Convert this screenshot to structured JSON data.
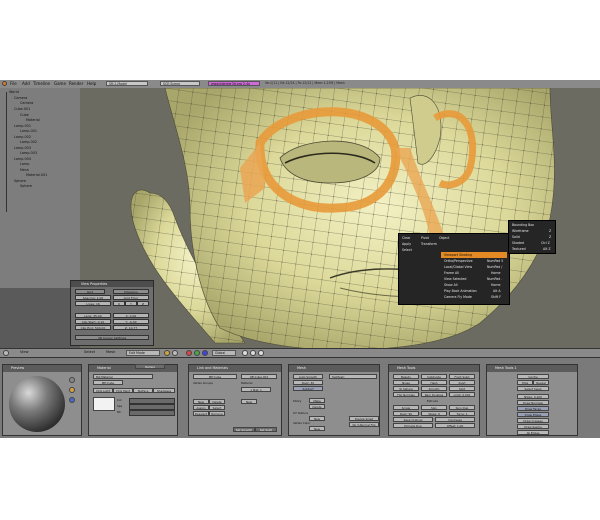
{
  "topbar": {
    "menus": [
      "File",
      "Add",
      "Timeline",
      "Game",
      "Render",
      "Help"
    ],
    "screen_field": "SR:2-Model",
    "scene_field": "SCE:Scene",
    "www_field": "www.blender3d.org 2.4x",
    "stats": "Ve:1/11 | Ed:12/24 | Fa:12/12 | Mem:1.23M | Mesh"
  },
  "outliner": {
    "items": [
      "World",
      "Camera",
      "Camera",
      "Cube.001",
      "Cube",
      "Material",
      "Lamp.001",
      "Lamp.001",
      "Lamp.002",
      "Lamp.002",
      "Lamp.003",
      "Lamp.003",
      "Lamp.004",
      "Lamp",
      "Mesh",
      "Material.001",
      "Sphere",
      "Sphere"
    ]
  },
  "view_properties": {
    "title": "View Properties",
    "rows": [
      [
        "Grid",
        "Divisions"
      ],
      [
        "Spacing: 1.00",
        "Grid Floor"
      ],
      [
        "Lines: 16",
        "X",
        "Y",
        "Z"
      ],
      [
        "Lens: 35.00",
        "X: 0.00"
      ],
      [
        "Clip Start: 0.10",
        "Y: -0.40"
      ],
      [
        "Clip End: 500.00",
        "Z: 10.77"
      ]
    ],
    "footer": "3D Cursor Settings"
  },
  "viewport_header": {
    "view": "View",
    "select": "Select",
    "mesh": "Mesh",
    "mode": "Edit Mode",
    "global": "Global"
  },
  "context_menu": {
    "left_col": [
      "Clear",
      "Apply",
      "Select"
    ],
    "mid_col": [
      "Pivot",
      "Transform",
      "Object"
    ],
    "items": [
      {
        "label": "Viewport Shading",
        "shortcut": ""
      },
      {
        "label": "Ortho/Perspective",
        "shortcut": "NumPad 5"
      },
      {
        "label": "Local/Global View",
        "shortcut": "NumPad /"
      },
      {
        "label": "Frame All",
        "shortcut": "Home"
      },
      {
        "label": "View Selected",
        "shortcut": "NumPad ."
      },
      {
        "label": "Show All",
        "shortcut": "Home"
      },
      {
        "label": "Play Back Animation",
        "shortcut": "Alt A"
      },
      {
        "label": "Camera Fly Mode",
        "shortcut": "Shift F"
      }
    ],
    "highlight_label": "Viewport Shading",
    "submenu": [
      {
        "label": "Bounding Box",
        "shortcut": ""
      },
      {
        "label": "Wireframe",
        "shortcut": "Z"
      },
      {
        "label": "Solid",
        "shortcut": "Z"
      },
      {
        "label": "Shaded",
        "shortcut": "Ctrl Z"
      },
      {
        "label": "Textured",
        "shortcut": "Alt Z"
      }
    ]
  },
  "buttons": {
    "panels": [
      {
        "title": "Preview"
      },
      {
        "title": "Material",
        "tabs": [
          "Material",
          "Ramps"
        ]
      },
      {
        "title": "Link and Materials"
      },
      {
        "title": "Mesh"
      },
      {
        "title": "Mesh Tools"
      },
      {
        "title": "Mesh Tools 1"
      }
    ],
    "material": {
      "name": "MA:Material",
      "links": "ME:Cube",
      "options": [
        "VCol Light",
        "VCol Paint",
        "TexFace",
        "Shadeless"
      ],
      "sliders": [
        "Col",
        "Spe",
        "Mir"
      ]
    },
    "link": {
      "mesh": "ME:Cube",
      "ob": "OB:Cube.001",
      "vertex_groups": "Vertex Groups",
      "material_label": "Material",
      "mat_index": "1 Mat: 1",
      "btns": [
        "New",
        "Delete",
        "Assign",
        "Select",
        "Deselect",
        "Remove",
        "Set Smooth",
        "Set Solid"
      ],
      "new_mat": "New"
    },
    "mesh": {
      "auto_smooth": "Auto Smooth",
      "degr": "Degr: 30",
      "subsurf": "SubSurf",
      "sticky": "Sticky",
      "uv": "UV Texture",
      "vert_col": "Vertex Color",
      "btns": [
        "Make",
        "Make",
        "Delete",
        "Delete",
        "New",
        "New"
      ],
      "texmesh": "TexMesh:",
      "double_sided": "Double Sided",
      "no_v_normal": "No V.Normal Flip"
    },
    "tools": {
      "row1": [
        "Beauty",
        "Subdivide",
        "Fract Subd"
      ],
      "row2": [
        "Noise",
        "Hash",
        "Xsort"
      ],
      "row3": [
        "To Sphere",
        "Smooth",
        "Split"
      ],
      "flip": "Flip Normals",
      "rem_doubles": "Rem Doubles",
      "limit": "Limit: 0.001",
      "extrude": "Extrude",
      "spin": "Spin",
      "spin_dup": "Spin Dup",
      "screw": "Screw",
      "degr": "Degr: 90",
      "steps": "Steps: 9",
      "turns": "Turns: 1",
      "keep_original": "Keep Original",
      "clockwise": "Clockwise",
      "extrude_dup": "Extrude Dup",
      "offset": "Offset: 1.00"
    },
    "tools1": {
      "centre": "Centre",
      "hide": "Hide",
      "reveal": "Reveal",
      "select_swap": "Select Swap",
      "nsize": "NSize: 0.100",
      "draw_normals": "Draw Normals",
      "draw_faces": "Draw Faces",
      "draw_edges": "Draw Edges",
      "draw_creases": "Draw Creases",
      "draw_seams": "Draw Seams",
      "all_edges": "All Edges"
    }
  }
}
